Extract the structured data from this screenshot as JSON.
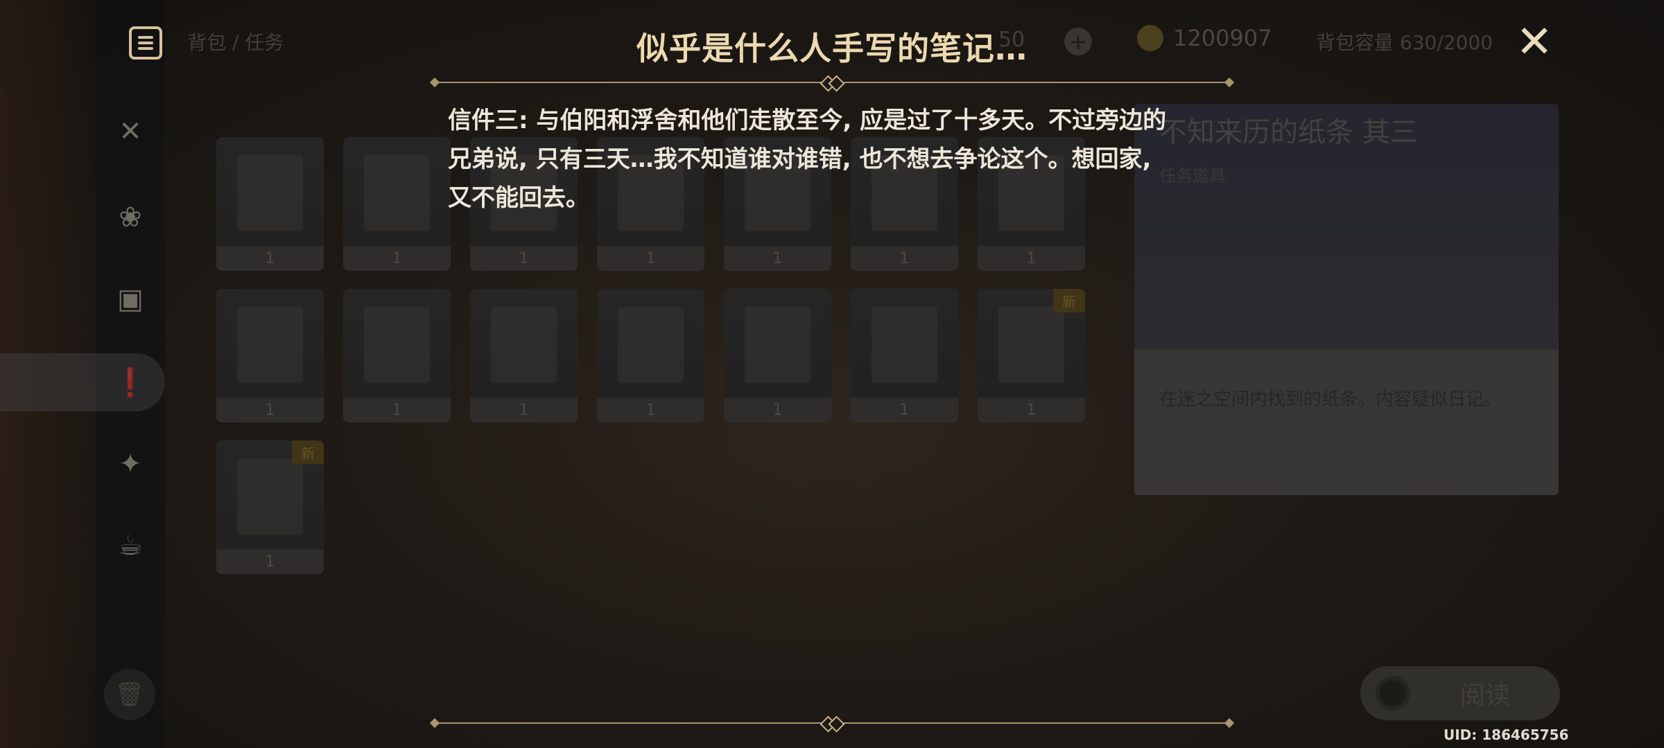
{
  "background": {
    "breadcrumb": "背包 / 任务",
    "item_counter": "50",
    "currency": "1200907",
    "capacity": "背包容量 630/2000",
    "nav_icons": [
      "utensils-icon",
      "material-icon",
      "furnishing-icon",
      "quest-icon",
      "precious-item-icon",
      "teapot-icon"
    ],
    "grid": {
      "rows": [
        [
          {
            "qty": "1",
            "new": ""
          },
          {
            "qty": "1",
            "new": ""
          },
          {
            "qty": "1",
            "new": ""
          },
          {
            "qty": "1",
            "new": ""
          },
          {
            "qty": "1",
            "new": ""
          },
          {
            "qty": "1",
            "new": ""
          },
          {
            "qty": "1",
            "new": ""
          }
        ],
        [
          {
            "qty": "1",
            "new": ""
          },
          {
            "qty": "1",
            "new": ""
          },
          {
            "qty": "1",
            "new": ""
          },
          {
            "qty": "1",
            "new": ""
          },
          {
            "qty": "1",
            "new": ""
          },
          {
            "qty": "1",
            "new": ""
          },
          {
            "qty": "1",
            "new": "新"
          }
        ],
        [
          {
            "qty": "1",
            "new": "新"
          }
        ]
      ]
    },
    "detail": {
      "name": "不知来历的纸条 其三",
      "type": "任务道具",
      "description": "在迷之空间内找到的纸条。内容疑似日记。"
    },
    "read_button": "阅读",
    "uid": "UID: 186465756"
  },
  "dialog": {
    "title": "似乎是什么人手写的笔记…",
    "lines": [
      "信件三: 与伯阳和浮舍和他们走散至今, 应是过了十多天。不过旁边的",
      "兄弟说, 只有三天…我不知道谁对谁错, 也不想去争论这个。想回家,",
      "又不能回去。"
    ]
  }
}
